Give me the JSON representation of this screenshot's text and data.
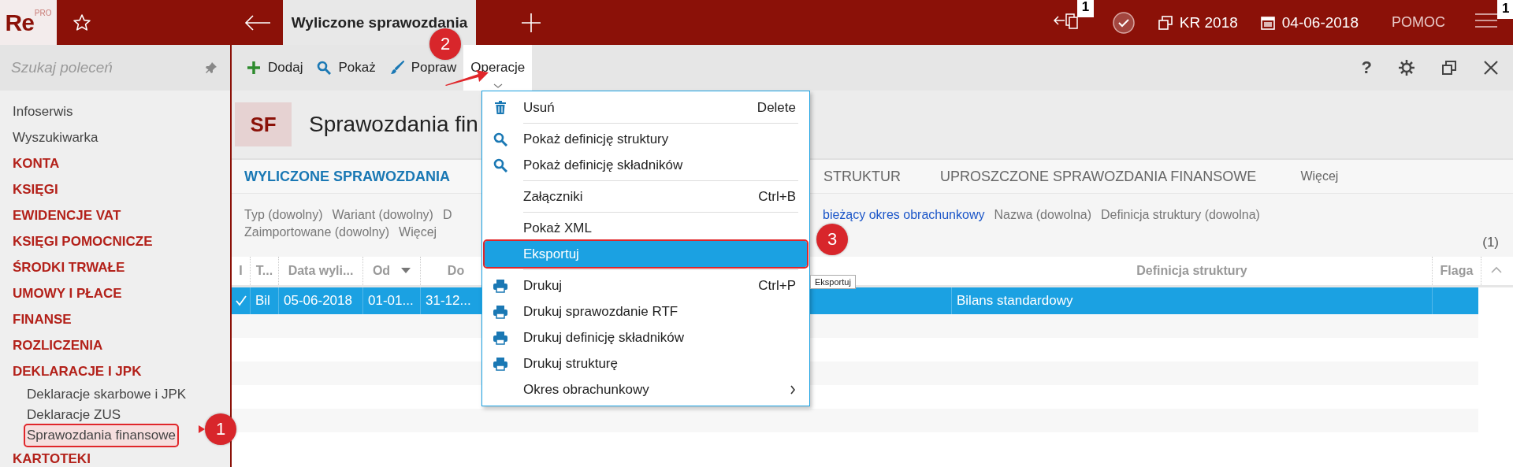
{
  "topbar": {
    "logo": "Re",
    "logo_sup": "PRO",
    "tab": "Wyliczone sprawozdania",
    "tasks_count": "1",
    "period": "KR 2018",
    "date": "04-06-2018",
    "help": "POMOC",
    "menu_count": "1"
  },
  "sidebar": {
    "search": {
      "placeholder": "Szukaj poleceń"
    },
    "items": [
      {
        "label": "Infoserwis",
        "kind": "link"
      },
      {
        "label": "Wyszukiwarka",
        "kind": "link"
      },
      {
        "label": "KONTA",
        "kind": "section"
      },
      {
        "label": "KSIĘGI",
        "kind": "section"
      },
      {
        "label": "EWIDENCJE VAT",
        "kind": "section"
      },
      {
        "label": "KSIĘGI POMOCNICZE",
        "kind": "section"
      },
      {
        "label": "ŚRODKI TRWAŁE",
        "kind": "section"
      },
      {
        "label": "UMOWY I PŁACE",
        "kind": "section"
      },
      {
        "label": "FINANSE",
        "kind": "section"
      },
      {
        "label": "ROZLICZENIA",
        "kind": "section"
      },
      {
        "label": "DEKLARACJE I JPK",
        "kind": "section",
        "children": [
          {
            "label": "Deklaracje skarbowe i JPK",
            "selected": false
          },
          {
            "label": "Deklaracje ZUS",
            "selected": false
          },
          {
            "label": "Sprawozdania finansowe",
            "selected": true
          }
        ]
      },
      {
        "label": "KARTOTEKI",
        "kind": "section"
      }
    ]
  },
  "toolbar": {
    "buttons": [
      {
        "label": "Dodaj",
        "kind": "add",
        "selected": false
      },
      {
        "label": "Pokaż",
        "kind": "show",
        "selected": false
      },
      {
        "label": "Popraw",
        "kind": "edit",
        "selected": false
      },
      {
        "label": "Operacje",
        "kind": "menu",
        "selected": true
      }
    ],
    "tools": [
      {
        "kind": "help",
        "label": "?"
      },
      {
        "kind": "settings"
      },
      {
        "kind": "restore"
      },
      {
        "kind": "close"
      }
    ]
  },
  "header": {
    "code": "SF",
    "title": "Sprawozdania fin"
  },
  "tabs": [
    {
      "label": "WYLICZONE SPRAWOZDANIA",
      "selected": true
    },
    {
      "label": "STRUKTUR",
      "selected": false
    },
    {
      "label": "UPROSZCZONE SPRAWOZDANIA FINANSOWE",
      "selected": false
    },
    {
      "label": "Więcej",
      "selected": false
    }
  ],
  "filters": [
    {
      "label": "Typ (dowolny)",
      "active": false
    },
    {
      "label": "Wariant (dowolny)",
      "active": false
    },
    {
      "label": "D",
      "active": false
    },
    {
      "label": "bieżący okres obrachunkowy",
      "active": true
    },
    {
      "label": "Nazwa (dowolna)",
      "active": false
    },
    {
      "label": "Definicja struktury (dowolna)",
      "active": false
    },
    {
      "label": "Zaimportowane (dowolny)",
      "active": false
    },
    {
      "label": "Więcej",
      "active": false
    }
  ],
  "count": "(1)",
  "table": {
    "columns": [
      "I",
      "T...",
      "Data wyli...",
      "Od",
      "Do",
      "Definicja struktury",
      "Flaga"
    ],
    "rows": [
      {
        "selected": true,
        "checked": true,
        "cells": [
          "",
          "Bil",
          "05-06-2018",
          "01-01...",
          "31-12...",
          "Bilans standardowy"
        ]
      }
    ]
  },
  "menu": {
    "items": [
      {
        "label": "Usuń",
        "kind": "trash",
        "shortcut": "Delete",
        "selected": false
      },
      {
        "label": "Pokaż definicję struktury",
        "kind": "search",
        "separator_before": true,
        "selected": false
      },
      {
        "label": "Pokaż definicję składników",
        "kind": "search",
        "selected": false
      },
      {
        "label": "Załączniki",
        "kind": "plain",
        "shortcut": "Ctrl+B",
        "separator_before": true,
        "selected": false
      },
      {
        "label": "Pokaż XML",
        "kind": "plain",
        "separator_before": true,
        "selected": false
      },
      {
        "label": "Eksportuj",
        "kind": "plain",
        "selected": true
      },
      {
        "label": "Drukuj",
        "kind": "print",
        "shortcut": "Ctrl+P",
        "separator_before": true,
        "selected": false
      },
      {
        "label": "Drukuj sprawozdanie RTF",
        "kind": "print",
        "selected": false
      },
      {
        "label": "Drukuj definicję składników",
        "kind": "print",
        "selected": false
      },
      {
        "label": "Drukuj strukturę",
        "kind": "print",
        "selected": false
      },
      {
        "label": "Okres obrachunkowy",
        "kind": "plain",
        "submenu": true,
        "selected": false
      }
    ]
  },
  "tooltip": "Eksportuj",
  "annotations": [
    {
      "label": "1",
      "kind": "callout"
    },
    {
      "label": "2",
      "kind": "arrow"
    },
    {
      "label": "3",
      "kind": "badge"
    }
  ]
}
